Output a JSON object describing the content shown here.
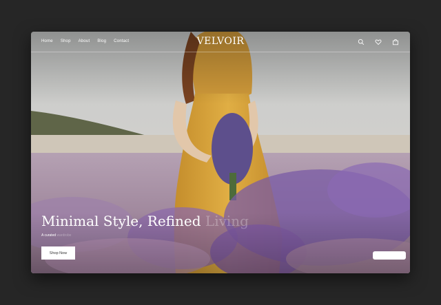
{
  "brand": "VELVOIR",
  "nav": {
    "items": [
      {
        "label": "Home"
      },
      {
        "label": "Shop"
      },
      {
        "label": "About"
      },
      {
        "label": "Blog"
      },
      {
        "label": "Contact"
      }
    ],
    "icons": [
      "search-icon",
      "heart-icon",
      "bag-icon"
    ]
  },
  "hero": {
    "title_main": "Minimal Style,",
    "title_second": "Refined",
    "title_faded": "Living",
    "subtitle_main": "A curated",
    "subtitle_faded": "wardrobe",
    "cta_label": "Shop Now"
  },
  "colors": {
    "page_bg": "#262626",
    "sky": "#d3d4d1",
    "dress": "#d9a73c",
    "lavender": "#8a6ab4",
    "field": "#a98fa8"
  }
}
